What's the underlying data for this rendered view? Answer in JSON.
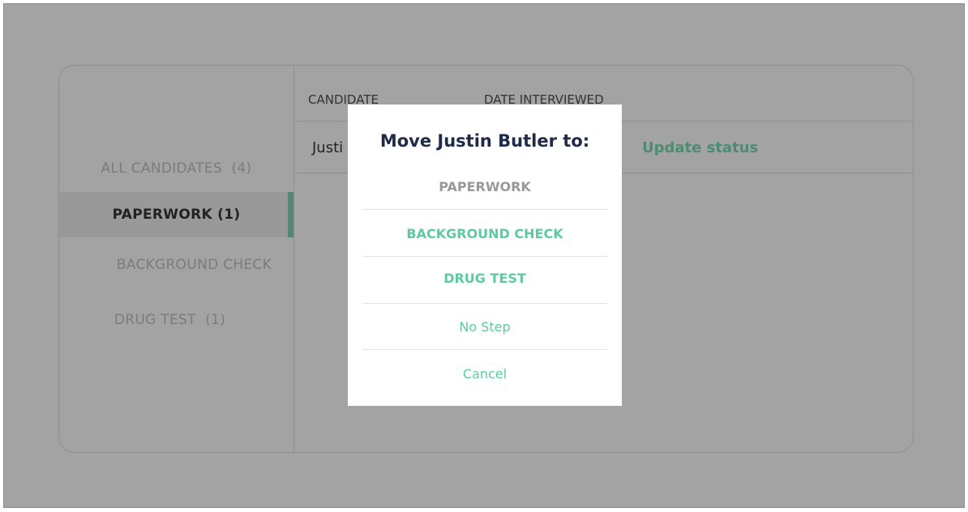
{
  "sidebar": {
    "items": [
      {
        "label": "ALL CANDIDATES  (4)"
      },
      {
        "label": "PAPERWORK (1)",
        "active": true
      },
      {
        "label": "BACKGROUND CHECK"
      },
      {
        "label": "DRUG TEST  (1)"
      }
    ]
  },
  "table": {
    "headers": [
      "CANDIDATE",
      "DATE INTERVIEWED"
    ],
    "rows": [
      {
        "candidate": "Justi",
        "action": "Update status"
      }
    ]
  },
  "modal": {
    "title": "Move Justin Butler to:",
    "options": [
      "PAPERWORK",
      "BACKGROUND CHECK",
      "DRUG TEST",
      "No Step"
    ],
    "cancel": "Cancel"
  },
  "colors": {
    "accent": "#5ccba0",
    "accent_dimmed": "#4e8b74",
    "title": "#1e2a4a",
    "disabled": "#999999"
  }
}
